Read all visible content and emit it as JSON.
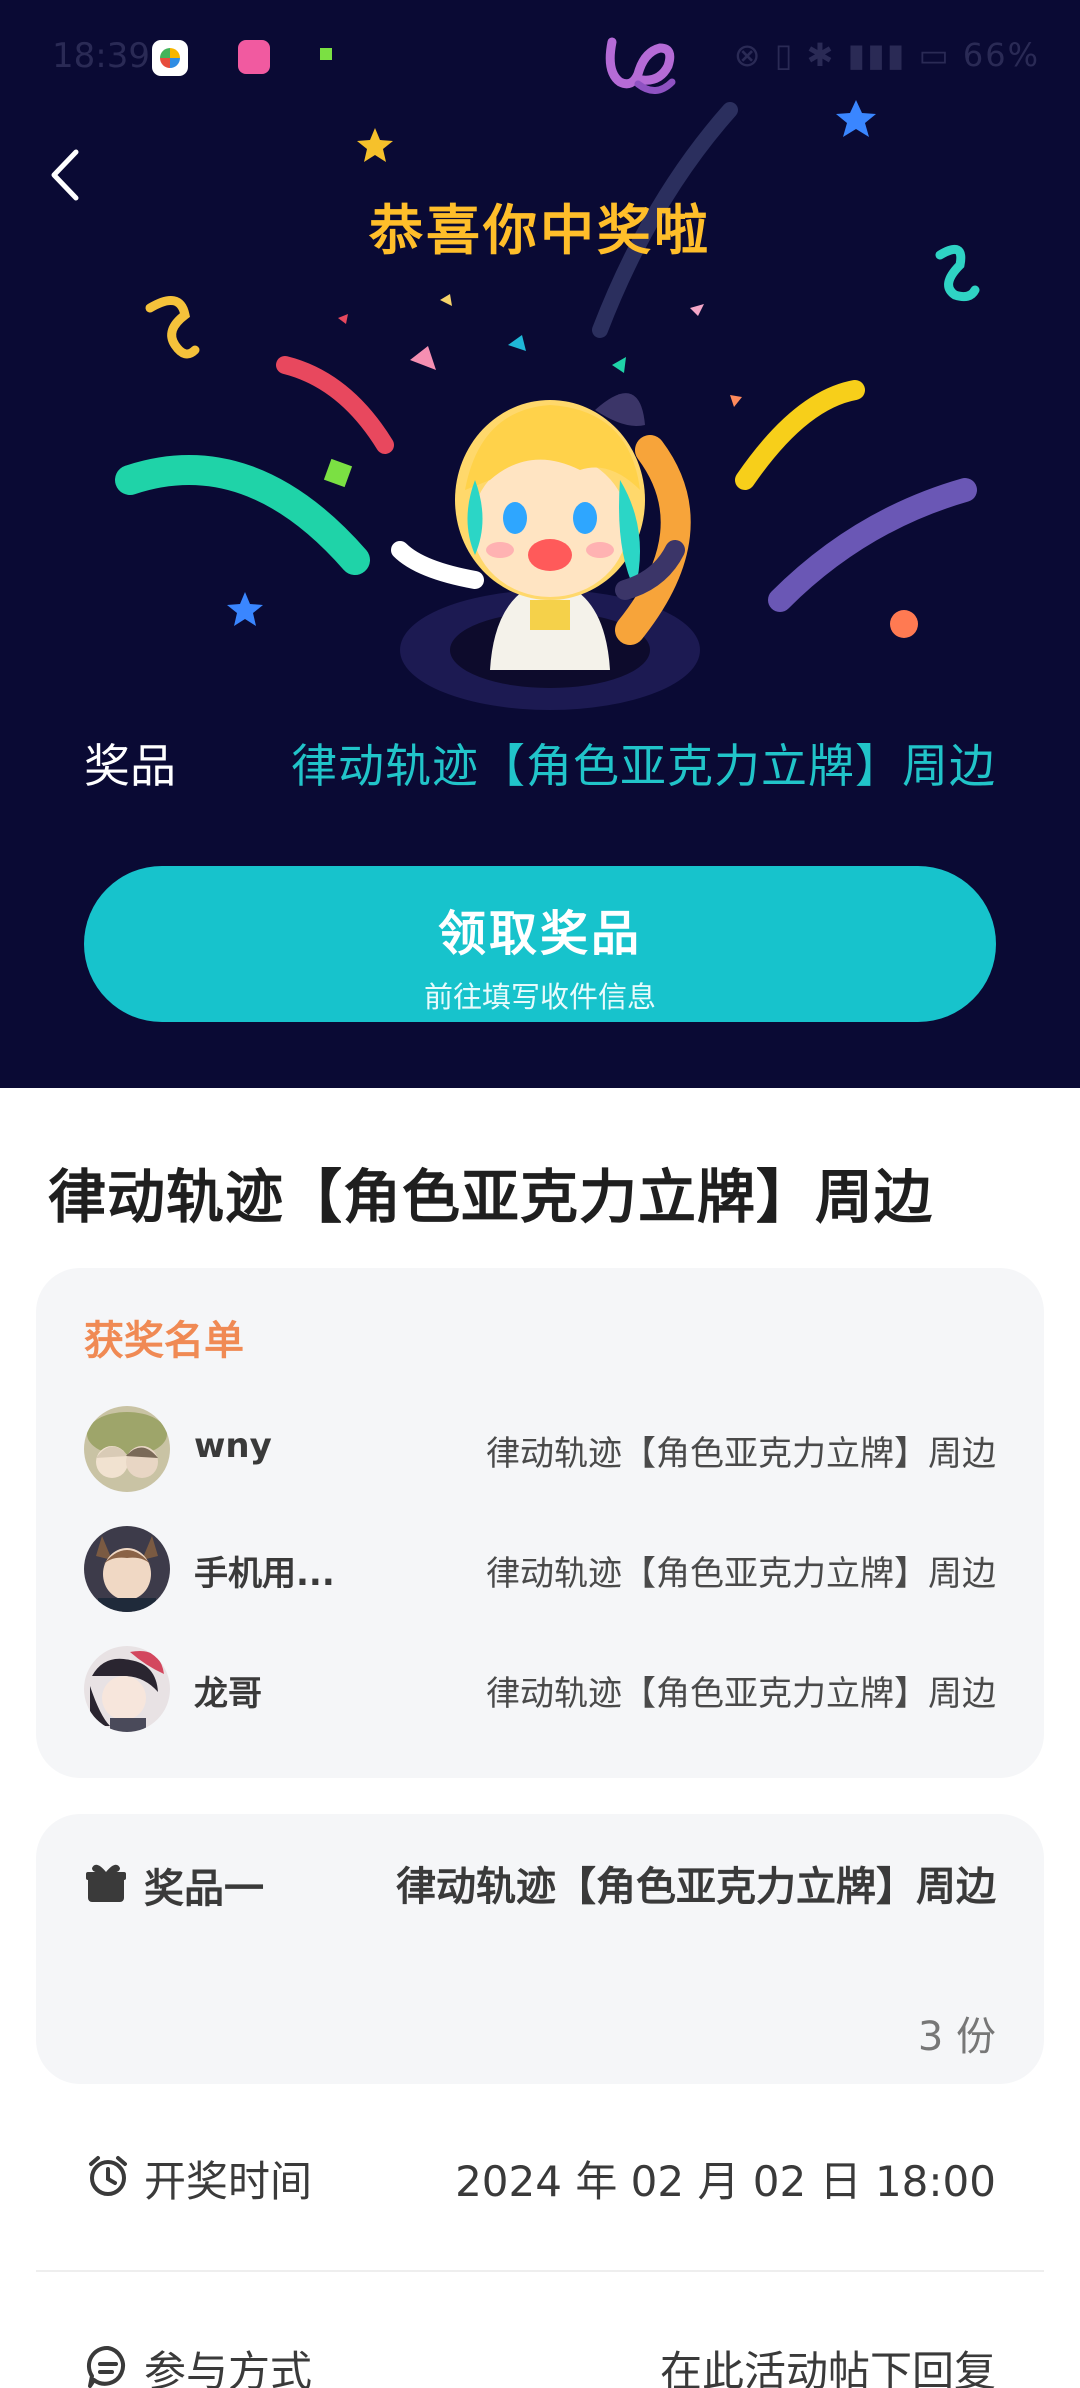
{
  "status_bar": {
    "time": "18:39",
    "right_text": "⊗ ▯ ✱ ▮▮▮ ▭ 66%"
  },
  "hero": {
    "title": "恭喜你中奖啦",
    "prize_label": "奖品",
    "prize_name": "律动轨迹【角色亚克力立牌】周边",
    "claim_button": {
      "title": "领取奖品",
      "subtitle": "前往填写收件信息"
    }
  },
  "page_title": "律动轨迹【角色亚克力立牌】周边",
  "winners": {
    "heading": "获奖名单",
    "rows": [
      {
        "name": "wny",
        "prize": "律动轨迹【角色亚克力立牌】周边"
      },
      {
        "name": "手机用...",
        "prize": "律动轨迹【角色亚克力立牌】周边"
      },
      {
        "name": "龙哥",
        "prize": "律动轨迹【角色亚克力立牌】周边"
      }
    ]
  },
  "prize_detail": {
    "label": "奖品一",
    "name": "律动轨迹【角色亚克力立牌】周边",
    "quantity": "3 份"
  },
  "draw_time": {
    "label": "开奖时间",
    "value": "2024 年 02 月 02 日 18:00"
  },
  "participation": {
    "label": "参与方式",
    "value": "在此活动帖下回复"
  },
  "colors": {
    "hero_bg": "#0a0a34",
    "title_yellow": "#ffbe2a",
    "accent_teal": "#17c3cc",
    "winners_heading": "#f08a54",
    "card_bg": "#f5f6f8"
  }
}
